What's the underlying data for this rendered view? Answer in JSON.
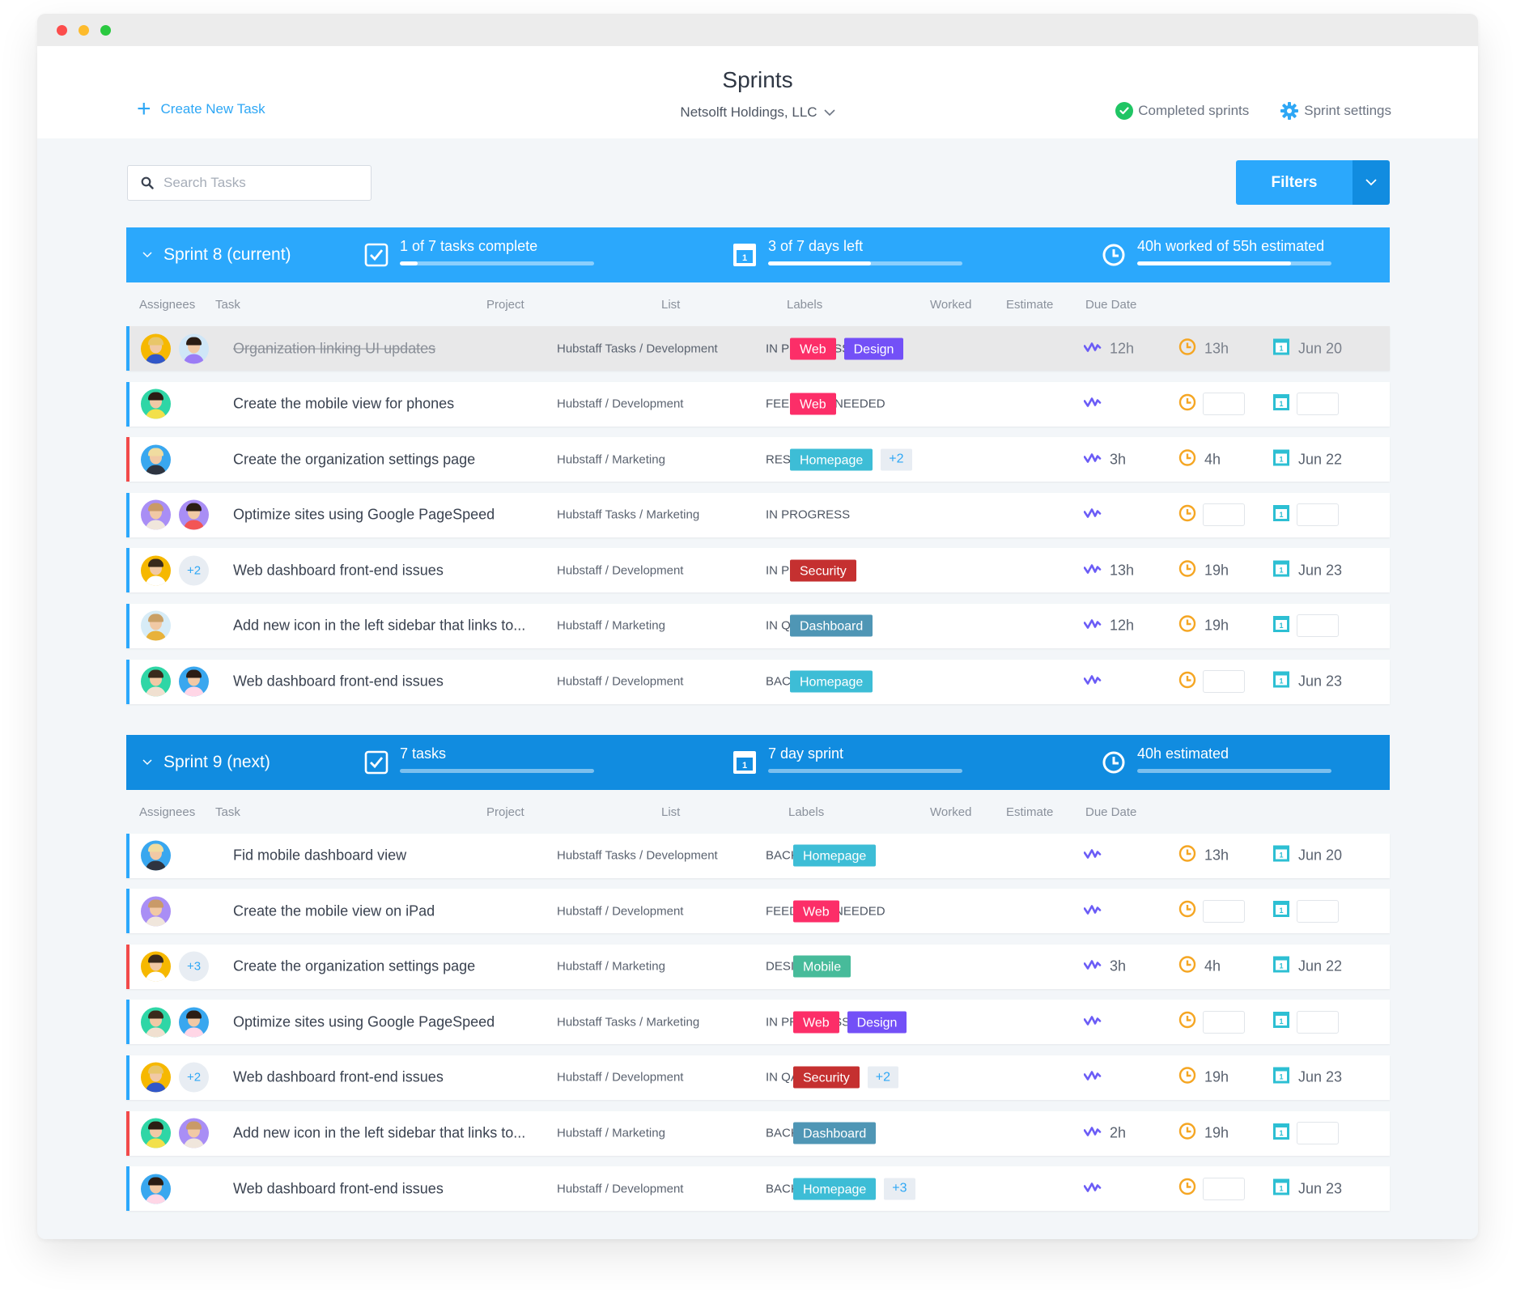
{
  "window": {
    "title": "Sprints",
    "organization": "Netsolft Holdings, LLC",
    "create_task_label": "Create New Task",
    "completed_sprints_label": "Completed sprints",
    "sprint_settings_label": "Sprint settings",
    "search_placeholder": "Search Tasks",
    "filters_label": "Filters"
  },
  "colors": {
    "accent": "#2ba8fc",
    "accent_dark": "#118ce0",
    "priority_red": "#f24a4a",
    "worked_icon": "#6b5cf6",
    "estimate_icon": "#f5a623",
    "due_icon": "#2dbfd3",
    "labels": {
      "Web": "#fc2e68",
      "Design": "#7350f7",
      "Homepage": "#3dbdd6",
      "Security": "#c53030",
      "Dashboard": "#4f96b5",
      "Mobile": "#47bb9a"
    }
  },
  "columns": [
    "Assignees",
    "Task",
    "Project",
    "List",
    "Labels",
    "Worked",
    "Estimate",
    "Due Date"
  ],
  "sprints": [
    {
      "name": "Sprint 8 (current)",
      "variant": "current",
      "stats": [
        {
          "icon": "checkbox-icon",
          "text": "1 of 7 tasks complete",
          "progress": 0.09
        },
        {
          "icon": "calendar-icon",
          "text": "3 of 7 days left",
          "progress": 0.53
        },
        {
          "icon": "clock-icon",
          "text": "40h worked of 55h estimated",
          "progress": 0.79
        }
      ],
      "tasks": [
        {
          "assignees": [
            {
              "bg": "#f6b800",
              "hair": "#e8c66a",
              "body": "#3157c8"
            },
            {
              "bg": "#cfe6f7",
              "hair": "#2b1d14",
              "body": "#9b7cf5"
            }
          ],
          "more": "",
          "title": "Organization linking UI updates",
          "done": true,
          "priority": "normal",
          "project": "Hubstaff Tasks / Development",
          "list": "IN PROGRESS",
          "labels": [
            "Web",
            "Design"
          ],
          "labels_more": "",
          "worked": "12h",
          "estimate": "13h",
          "due": "Jun 20"
        },
        {
          "assignees": [
            {
              "bg": "#2fd6a6",
              "hair": "#2b1d14",
              "body": "#f2e04b"
            }
          ],
          "more": "",
          "title": "Create the mobile view for phones",
          "done": false,
          "priority": "normal",
          "project": "Hubstaff / Development",
          "list": "FEEDBACK NEEDED",
          "labels": [
            "Web"
          ],
          "labels_more": "",
          "worked": "",
          "estimate": "",
          "due": ""
        },
        {
          "assignees": [
            {
              "bg": "#39a7ef",
              "hair": "#f0dca0",
              "body": "#2e3440"
            }
          ],
          "more": "",
          "title": "Create the organization settings page",
          "done": false,
          "priority": "high",
          "project": "Hubstaff / Marketing",
          "list": "RESEARCH",
          "labels": [
            "Homepage"
          ],
          "labels_more": "+2",
          "worked": "3h",
          "estimate": "4h",
          "due": "Jun 22"
        },
        {
          "assignees": [
            {
              "bg": "#a98ef5",
              "hair": "#c99a68",
              "body": "#f0e6dc"
            },
            {
              "bg": "#a98ef5",
              "hair": "#2b1d14",
              "body": "#f25555"
            }
          ],
          "more": "",
          "title": "Optimize sites using Google PageSpeed",
          "done": false,
          "priority": "normal",
          "project": "Hubstaff Tasks / Marketing",
          "list": "IN PROGRESS",
          "labels": [],
          "labels_more": "",
          "worked": "",
          "estimate": "",
          "due": ""
        },
        {
          "assignees": [
            {
              "bg": "#f6b800",
              "hair": "#3a2a1c",
              "body": "#ffffff"
            }
          ],
          "more": "+2",
          "title": "Web dashboard front-end issues",
          "done": false,
          "priority": "normal",
          "project": "Hubstaff / Development",
          "list": "IN PROGRESS",
          "labels": [
            "Security"
          ],
          "labels_more": "",
          "worked": "13h",
          "estimate": "19h",
          "due": "Jun 23"
        },
        {
          "assignees": [
            {
              "bg": "#d7ecf7",
              "hair": "#c9a066",
              "body": "#e8b23a"
            }
          ],
          "more": "",
          "title": "Add new icon in the left sidebar that links to...",
          "done": false,
          "priority": "normal",
          "project": "Hubstaff / Marketing",
          "list": "IN QA",
          "labels": [
            "Dashboard"
          ],
          "labels_more": "",
          "worked": "12h",
          "estimate": "19h",
          "due": ""
        },
        {
          "assignees": [
            {
              "bg": "#2fd6a6",
              "hair": "#3a2a1c",
              "body": "#f0e0d0"
            },
            {
              "bg": "#39a7ef",
              "hair": "#2b1d14",
              "body": "#ffd6e6"
            }
          ],
          "more": "",
          "title": "Web dashboard front-end issues",
          "done": false,
          "priority": "normal",
          "project": "Hubstaff / Development",
          "list": "BACKLOG",
          "labels": [
            "Homepage"
          ],
          "labels_more": "",
          "worked": "",
          "estimate": "",
          "due": "Jun 23"
        }
      ]
    },
    {
      "name": "Sprint 9 (next)",
      "variant": "next",
      "stats": [
        {
          "icon": "checkbox-icon",
          "text": "7 tasks",
          "progress": 0
        },
        {
          "icon": "calendar-icon",
          "text": "7 day sprint",
          "progress": 0
        },
        {
          "icon": "clock-icon",
          "text": "40h estimated",
          "progress": 0
        }
      ],
      "tasks": [
        {
          "assignees": [
            {
              "bg": "#39a7ef",
              "hair": "#f0dca0",
              "body": "#2e3440"
            }
          ],
          "more": "",
          "title": "Fid mobile dashboard view",
          "done": false,
          "priority": "normal",
          "project": "Hubstaff Tasks / Development",
          "list": "BACKLOG",
          "labels": [
            "Homepage"
          ],
          "labels_more": "",
          "worked": "",
          "estimate": "13h",
          "due": "Jun 20"
        },
        {
          "assignees": [
            {
              "bg": "#a98ef5",
              "hair": "#c99a68",
              "body": "#f0e6dc"
            }
          ],
          "more": "",
          "title": "Create the mobile view on iPad",
          "done": false,
          "priority": "normal",
          "project": "Hubstaff / Development",
          "list": "FEEDBACK NEEDED",
          "labels": [
            "Web"
          ],
          "labels_more": "",
          "worked": "",
          "estimate": "",
          "due": ""
        },
        {
          "assignees": [
            {
              "bg": "#f6b800",
              "hair": "#3a2a1c",
              "body": "#ffffff"
            }
          ],
          "more": "+3",
          "title": "Create the organization settings page",
          "done": false,
          "priority": "high",
          "project": "Hubstaff / Marketing",
          "list": "DESIGN",
          "labels": [
            "Mobile"
          ],
          "labels_more": "",
          "worked": "3h",
          "estimate": "4h",
          "due": "Jun 22"
        },
        {
          "assignees": [
            {
              "bg": "#2fd6a6",
              "hair": "#3a2a1c",
              "body": "#f0e0d0"
            },
            {
              "bg": "#39a7ef",
              "hair": "#2b1d14",
              "body": "#ffd6e6"
            }
          ],
          "more": "",
          "title": "Optimize sites using Google PageSpeed",
          "done": false,
          "priority": "normal",
          "project": "Hubstaff Tasks / Marketing",
          "list": "IN PROGRESS",
          "labels": [
            "Web",
            "Design"
          ],
          "labels_more": "",
          "worked": "",
          "estimate": "",
          "due": ""
        },
        {
          "assignees": [
            {
              "bg": "#f6b800",
              "hair": "#e8c66a",
              "body": "#3157c8"
            }
          ],
          "more": "+2",
          "title": "Web dashboard front-end issues",
          "done": false,
          "priority": "normal",
          "project": "Hubstaff / Development",
          "list": "IN QA",
          "labels": [
            "Security"
          ],
          "labels_more": "+2",
          "worked": "",
          "estimate": "19h",
          "due": "Jun 23"
        },
        {
          "assignees": [
            {
              "bg": "#2fd6a6",
              "hair": "#2b1d14",
              "body": "#f2e04b"
            },
            {
              "bg": "#a98ef5",
              "hair": "#c99a68",
              "body": "#f0e6dc"
            }
          ],
          "more": "",
          "title": "Add new icon in the left sidebar that links to...",
          "done": false,
          "priority": "high",
          "project": "Hubstaff / Marketing",
          "list": "BACKLOG",
          "labels": [
            "Dashboard"
          ],
          "labels_more": "",
          "worked": "2h",
          "estimate": "19h",
          "due": ""
        },
        {
          "assignees": [
            {
              "bg": "#39a7ef",
              "hair": "#2b1d14",
              "body": "#ffd6e6"
            }
          ],
          "more": "",
          "title": "Web dashboard front-end issues",
          "done": false,
          "priority": "normal",
          "project": "Hubstaff / Development",
          "list": "BACKLOG",
          "labels": [
            "Homepage"
          ],
          "labels_more": "+3",
          "worked": "",
          "estimate": "",
          "due": "Jun 23"
        }
      ]
    }
  ]
}
